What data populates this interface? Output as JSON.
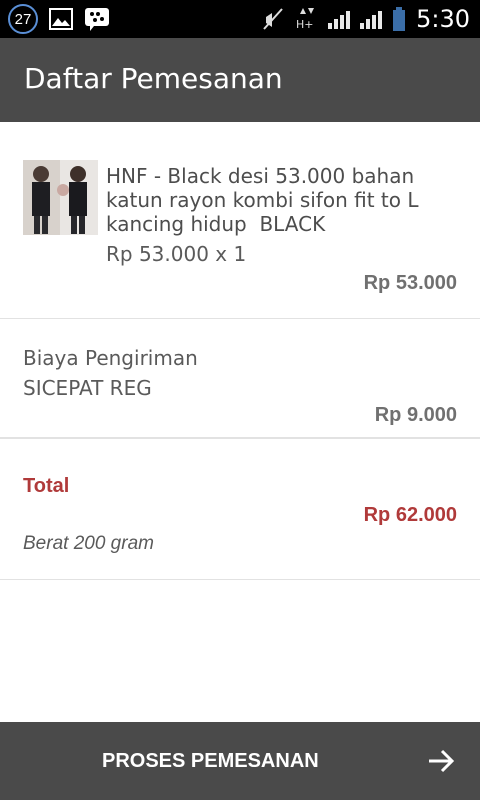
{
  "status_bar": {
    "notification_count": "27",
    "time": "5:30",
    "icons": [
      "notification-count-icon",
      "gallery-icon",
      "bbm-icon",
      "mute-icon",
      "data-hplus-icon",
      "signal-icon",
      "signal-icon-2",
      "battery-icon"
    ]
  },
  "header": {
    "title": "Daftar Pemesanan"
  },
  "order_item": {
    "name": "HNF - Black desi 53.000 bahan katun rayon kombi sifon fit to L kancing hidup  BLACK",
    "price_qty": "Rp 53.000 x 1",
    "subtotal": "Rp 53.000"
  },
  "shipping": {
    "label": "Biaya Pengiriman",
    "service": "SICEPAT REG",
    "cost": "Rp 9.000"
  },
  "total": {
    "label": "Total",
    "value": "Rp 62.000",
    "weight": "Berat 200 gram"
  },
  "footer": {
    "button_label": "PROSES PEMESANAN",
    "icon": "arrow-right-icon"
  },
  "colors": {
    "status_bar": "#000000",
    "app_bar": "#4a4a4a",
    "accent_total": "#b03a3a",
    "footer_bar": "#4a4a4a"
  }
}
